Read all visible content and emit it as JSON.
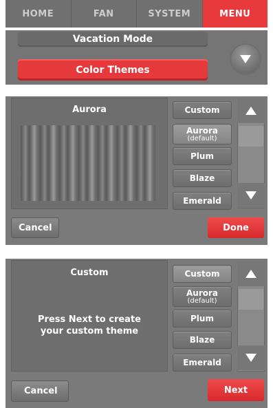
{
  "nav": {
    "tabs": [
      {
        "label": "HOME"
      },
      {
        "label": "FAN"
      },
      {
        "label": "SYSTEM"
      },
      {
        "label": "MENU"
      }
    ]
  },
  "menu": {
    "items": [
      {
        "label": "Vacation Mode"
      },
      {
        "label": "Color Themes"
      }
    ]
  },
  "screen1": {
    "preview_title": "Aurora",
    "themes": [
      {
        "label": "Custom",
        "sub": ""
      },
      {
        "label": "Aurora",
        "sub": "(default)"
      },
      {
        "label": "Plum",
        "sub": ""
      },
      {
        "label": "Blaze",
        "sub": ""
      },
      {
        "label": "Emerald",
        "sub": ""
      }
    ],
    "cancel_label": "Cancel",
    "action_label": "Done"
  },
  "screen2": {
    "preview_title": "Custom",
    "message_line1": "Press Next to create",
    "message_line2": "your custom theme",
    "themes": [
      {
        "label": "Custom",
        "sub": ""
      },
      {
        "label": "Aurora",
        "sub": "(default)"
      },
      {
        "label": "Plum",
        "sub": ""
      },
      {
        "label": "Blaze",
        "sub": ""
      },
      {
        "label": "Emerald",
        "sub": ""
      }
    ],
    "cancel_label": "Cancel",
    "action_label": "Next"
  },
  "colors": {
    "accent_red": "#e5393b",
    "panel_gray": "#7a7a7a"
  },
  "icons": {
    "scroll_up": "up-arrow-icon",
    "scroll_down": "down-arrow-icon",
    "menu_down": "down-arrow-icon"
  }
}
